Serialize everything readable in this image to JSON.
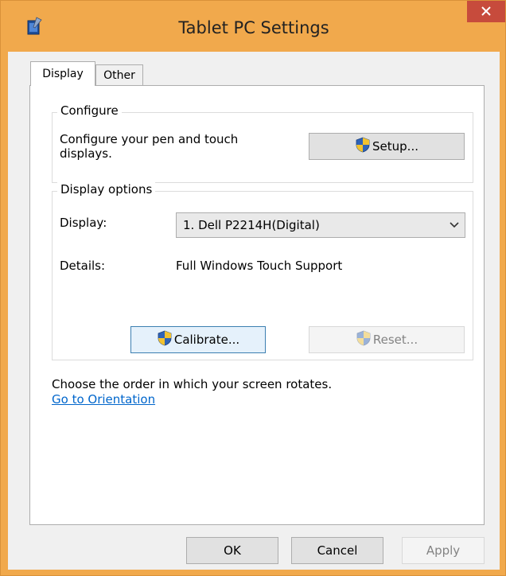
{
  "window": {
    "title": "Tablet PC Settings",
    "close_label": "×"
  },
  "tabs": [
    {
      "label": "Display",
      "selected": true
    },
    {
      "label": "Other",
      "selected": false
    }
  ],
  "configure": {
    "legend": "Configure",
    "description_line1": "Configure your pen and touch",
    "description_line2": "displays.",
    "setup_label": "Setup..."
  },
  "display_options": {
    "legend": "Display options",
    "display_label": "Display:",
    "display_selected": "1. Dell P2214H(Digital)",
    "details_label": "Details:",
    "details_value": "Full Windows Touch Support",
    "calibrate_label": "Calibrate...",
    "reset_label": "Reset..."
  },
  "orientation": {
    "text": "Choose the order in which your screen rotates.",
    "link": "Go to Orientation"
  },
  "footer": {
    "ok_label": "OK",
    "cancel_label": "Cancel",
    "apply_label": "Apply"
  },
  "colors": {
    "titlebar": "#f1a94c",
    "close": "#c74b3c",
    "link": "#0066cc",
    "focus_border": "#3c7fb1"
  },
  "icons": {
    "app": "tablet-pc-icon",
    "shield": "uac-shield-icon",
    "dropdown": "chevron-down-icon"
  }
}
